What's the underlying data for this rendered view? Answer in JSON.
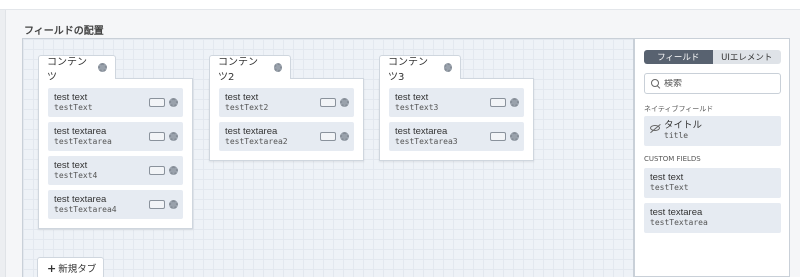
{
  "section_title": "フィールドの配置",
  "tabs": [
    {
      "label": "コンテンツ",
      "fields": [
        {
          "label": "test text",
          "key": "testText"
        },
        {
          "label": "test textarea",
          "key": "testTextarea"
        },
        {
          "label": "test text",
          "key": "testText4"
        },
        {
          "label": "test textarea",
          "key": "testTextarea4"
        }
      ]
    },
    {
      "label": "コンテンツ2",
      "fields": [
        {
          "label": "test text",
          "key": "testText2"
        },
        {
          "label": "test textarea",
          "key": "testTextarea2"
        }
      ]
    },
    {
      "label": "コンテンツ3",
      "fields": [
        {
          "label": "test text",
          "key": "testText3"
        },
        {
          "label": "test textarea",
          "key": "testTextarea3"
        }
      ]
    }
  ],
  "new_tab_label": "新規タブ",
  "side_panel": {
    "segments": {
      "fields": "フィールド",
      "ui_elements": "UIエレメント",
      "active": "fields"
    },
    "search": {
      "placeholder": "検索",
      "value": ""
    },
    "native_heading": "ネイティブフィールド",
    "native_fields": [
      {
        "label": "タイトル",
        "key": "title"
      }
    ],
    "custom_heading": "CUSTOM FIELDS",
    "custom_fields": [
      {
        "label": "test text",
        "key": "testText"
      },
      {
        "label": "test textarea",
        "key": "testTextarea"
      }
    ]
  },
  "colors": {
    "canvas_bg": "#eef2f7",
    "field_bg": "#e6ebf2",
    "segment_active": "#586270",
    "border": "#cfd6de"
  },
  "icons": {
    "gear": "gear-icon",
    "toggle": "toggle-icon",
    "search": "search-icon",
    "plus": "plus-icon",
    "hidden": "eye-off-icon"
  }
}
